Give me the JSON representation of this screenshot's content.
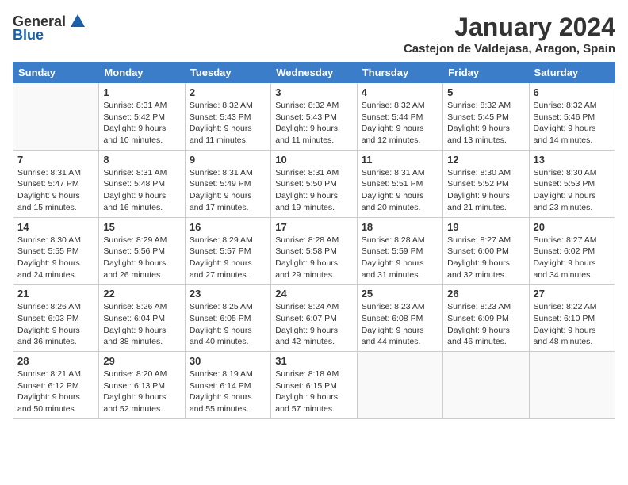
{
  "logo": {
    "general": "General",
    "blue": "Blue"
  },
  "title": "January 2024",
  "location": "Castejon de Valdejasa, Aragon, Spain",
  "weekdays": [
    "Sunday",
    "Monday",
    "Tuesday",
    "Wednesday",
    "Thursday",
    "Friday",
    "Saturday"
  ],
  "weeks": [
    [
      {
        "day": "",
        "info": ""
      },
      {
        "day": "1",
        "info": "Sunrise: 8:31 AM\nSunset: 5:42 PM\nDaylight: 9 hours\nand 10 minutes."
      },
      {
        "day": "2",
        "info": "Sunrise: 8:32 AM\nSunset: 5:43 PM\nDaylight: 9 hours\nand 11 minutes."
      },
      {
        "day": "3",
        "info": "Sunrise: 8:32 AM\nSunset: 5:43 PM\nDaylight: 9 hours\nand 11 minutes."
      },
      {
        "day": "4",
        "info": "Sunrise: 8:32 AM\nSunset: 5:44 PM\nDaylight: 9 hours\nand 12 minutes."
      },
      {
        "day": "5",
        "info": "Sunrise: 8:32 AM\nSunset: 5:45 PM\nDaylight: 9 hours\nand 13 minutes."
      },
      {
        "day": "6",
        "info": "Sunrise: 8:32 AM\nSunset: 5:46 PM\nDaylight: 9 hours\nand 14 minutes."
      }
    ],
    [
      {
        "day": "7",
        "info": "Sunrise: 8:31 AM\nSunset: 5:47 PM\nDaylight: 9 hours\nand 15 minutes."
      },
      {
        "day": "8",
        "info": "Sunrise: 8:31 AM\nSunset: 5:48 PM\nDaylight: 9 hours\nand 16 minutes."
      },
      {
        "day": "9",
        "info": "Sunrise: 8:31 AM\nSunset: 5:49 PM\nDaylight: 9 hours\nand 17 minutes."
      },
      {
        "day": "10",
        "info": "Sunrise: 8:31 AM\nSunset: 5:50 PM\nDaylight: 9 hours\nand 19 minutes."
      },
      {
        "day": "11",
        "info": "Sunrise: 8:31 AM\nSunset: 5:51 PM\nDaylight: 9 hours\nand 20 minutes."
      },
      {
        "day": "12",
        "info": "Sunrise: 8:30 AM\nSunset: 5:52 PM\nDaylight: 9 hours\nand 21 minutes."
      },
      {
        "day": "13",
        "info": "Sunrise: 8:30 AM\nSunset: 5:53 PM\nDaylight: 9 hours\nand 23 minutes."
      }
    ],
    [
      {
        "day": "14",
        "info": "Sunrise: 8:30 AM\nSunset: 5:55 PM\nDaylight: 9 hours\nand 24 minutes."
      },
      {
        "day": "15",
        "info": "Sunrise: 8:29 AM\nSunset: 5:56 PM\nDaylight: 9 hours\nand 26 minutes."
      },
      {
        "day": "16",
        "info": "Sunrise: 8:29 AM\nSunset: 5:57 PM\nDaylight: 9 hours\nand 27 minutes."
      },
      {
        "day": "17",
        "info": "Sunrise: 8:28 AM\nSunset: 5:58 PM\nDaylight: 9 hours\nand 29 minutes."
      },
      {
        "day": "18",
        "info": "Sunrise: 8:28 AM\nSunset: 5:59 PM\nDaylight: 9 hours\nand 31 minutes."
      },
      {
        "day": "19",
        "info": "Sunrise: 8:27 AM\nSunset: 6:00 PM\nDaylight: 9 hours\nand 32 minutes."
      },
      {
        "day": "20",
        "info": "Sunrise: 8:27 AM\nSunset: 6:02 PM\nDaylight: 9 hours\nand 34 minutes."
      }
    ],
    [
      {
        "day": "21",
        "info": "Sunrise: 8:26 AM\nSunset: 6:03 PM\nDaylight: 9 hours\nand 36 minutes."
      },
      {
        "day": "22",
        "info": "Sunrise: 8:26 AM\nSunset: 6:04 PM\nDaylight: 9 hours\nand 38 minutes."
      },
      {
        "day": "23",
        "info": "Sunrise: 8:25 AM\nSunset: 6:05 PM\nDaylight: 9 hours\nand 40 minutes."
      },
      {
        "day": "24",
        "info": "Sunrise: 8:24 AM\nSunset: 6:07 PM\nDaylight: 9 hours\nand 42 minutes."
      },
      {
        "day": "25",
        "info": "Sunrise: 8:23 AM\nSunset: 6:08 PM\nDaylight: 9 hours\nand 44 minutes."
      },
      {
        "day": "26",
        "info": "Sunrise: 8:23 AM\nSunset: 6:09 PM\nDaylight: 9 hours\nand 46 minutes."
      },
      {
        "day": "27",
        "info": "Sunrise: 8:22 AM\nSunset: 6:10 PM\nDaylight: 9 hours\nand 48 minutes."
      }
    ],
    [
      {
        "day": "28",
        "info": "Sunrise: 8:21 AM\nSunset: 6:12 PM\nDaylight: 9 hours\nand 50 minutes."
      },
      {
        "day": "29",
        "info": "Sunrise: 8:20 AM\nSunset: 6:13 PM\nDaylight: 9 hours\nand 52 minutes."
      },
      {
        "day": "30",
        "info": "Sunrise: 8:19 AM\nSunset: 6:14 PM\nDaylight: 9 hours\nand 55 minutes."
      },
      {
        "day": "31",
        "info": "Sunrise: 8:18 AM\nSunset: 6:15 PM\nDaylight: 9 hours\nand 57 minutes."
      },
      {
        "day": "",
        "info": ""
      },
      {
        "day": "",
        "info": ""
      },
      {
        "day": "",
        "info": ""
      }
    ]
  ]
}
